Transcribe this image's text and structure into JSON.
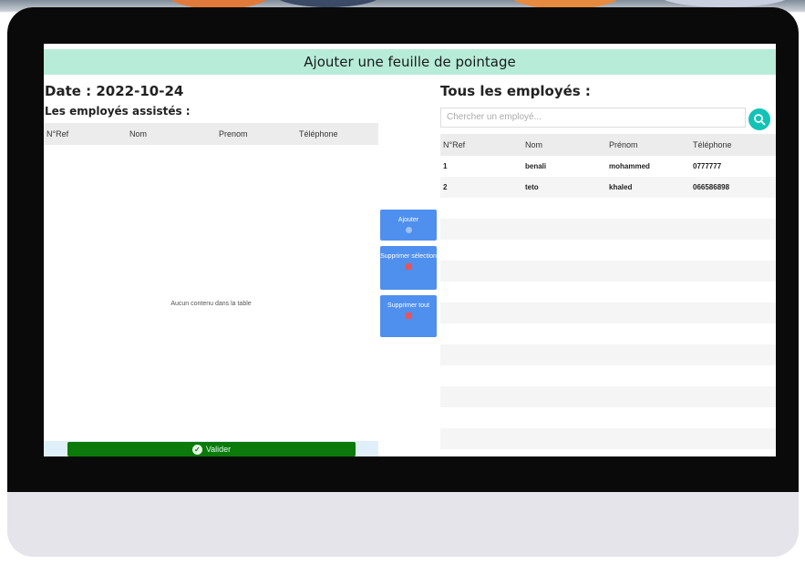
{
  "page": {
    "breadcrumb": "",
    "title": "Ajouter une feuille de pointage",
    "date_label": "Date :",
    "date_value": "2022-10-24",
    "assisted_title": "Les employés assistés :"
  },
  "left_table": {
    "columns": [
      "N°Ref",
      "Nom",
      "Prenom",
      "Téléphone"
    ],
    "empty_message": "Aucun contenu dans la table"
  },
  "actions": {
    "add_label": "Ajouter",
    "delete_selection_label": "Supprimer sélection",
    "delete_all_label": "Supprimer tout",
    "validate_label": "Valider"
  },
  "right_panel": {
    "title": "Tous les employés :",
    "search_placeholder": "Chercher un employé...",
    "columns": [
      "N°Ref",
      "Nom",
      "Prénom",
      "Téléphone"
    ],
    "rows": [
      {
        "ref": "1",
        "nom": "benali",
        "prenom": "mohammed",
        "tel": "0777777"
      },
      {
        "ref": "2",
        "nom": "teto",
        "prenom": "khaled",
        "tel": "066586898"
      }
    ]
  },
  "colors": {
    "title_bar": "#b7ecd9",
    "action_button": "#4f8fee",
    "validate_button": "#0b7a0b",
    "search_button": "#12c3b6"
  },
  "icons": {
    "add": "user-plus-icon",
    "delete": "trash-icon",
    "validate": "check-circle-icon",
    "search": "search-icon"
  }
}
